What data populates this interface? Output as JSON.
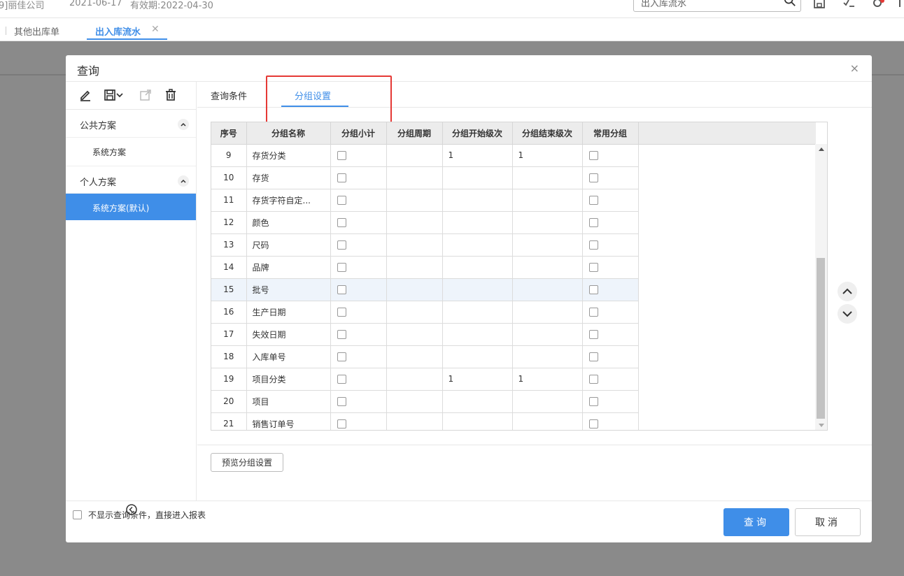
{
  "topbar": {
    "company": "9]丽佳公司",
    "date": "2021-06-17",
    "valid": "有效期:2022-04-30",
    "search_value": "出入库流水"
  },
  "tabs": [
    {
      "label": "其他出库单"
    },
    {
      "label": "出入库流水"
    }
  ],
  "modal": {
    "title": "查询",
    "close": "×",
    "left": {
      "public_title": "公共方案",
      "public_items": [
        "系统方案"
      ],
      "personal_title": "个人方案",
      "personal_items": [
        "系统方案(默认)"
      ]
    },
    "right_tabs": [
      {
        "label": "查询条件"
      },
      {
        "label": "分组设置"
      }
    ],
    "grid": {
      "headers": [
        "序号",
        "分组名称",
        "分组小计",
        "分组周期",
        "分组开始级次",
        "分组结束级次",
        "常用分组"
      ],
      "rows": [
        {
          "seq": "9",
          "name": "存货分类",
          "start": "1",
          "end": "1"
        },
        {
          "seq": "10",
          "name": "存货",
          "start": "",
          "end": ""
        },
        {
          "seq": "11",
          "name": "存货字符自定...",
          "start": "",
          "end": ""
        },
        {
          "seq": "12",
          "name": "颜色",
          "start": "",
          "end": ""
        },
        {
          "seq": "13",
          "name": "尺码",
          "start": "",
          "end": ""
        },
        {
          "seq": "14",
          "name": "品牌",
          "start": "",
          "end": ""
        },
        {
          "seq": "15",
          "name": "批号",
          "start": "",
          "end": ""
        },
        {
          "seq": "16",
          "name": "生产日期",
          "start": "",
          "end": ""
        },
        {
          "seq": "17",
          "name": "失效日期",
          "start": "",
          "end": ""
        },
        {
          "seq": "18",
          "name": "入库单号",
          "start": "",
          "end": ""
        },
        {
          "seq": "19",
          "name": "项目分类",
          "start": "1",
          "end": "1"
        },
        {
          "seq": "20",
          "name": "项目",
          "start": "",
          "end": ""
        },
        {
          "seq": "21",
          "name": "销售订单号",
          "start": "",
          "end": ""
        }
      ]
    },
    "preview_label": "预览分组设置",
    "footer": {
      "checkbox_label": "不显示查询条件，直接进入报表",
      "query_label": "查询",
      "cancel_label": "取消"
    }
  },
  "colors": {
    "accent": "#3f8ee8",
    "highlight_box": "#e53935"
  }
}
